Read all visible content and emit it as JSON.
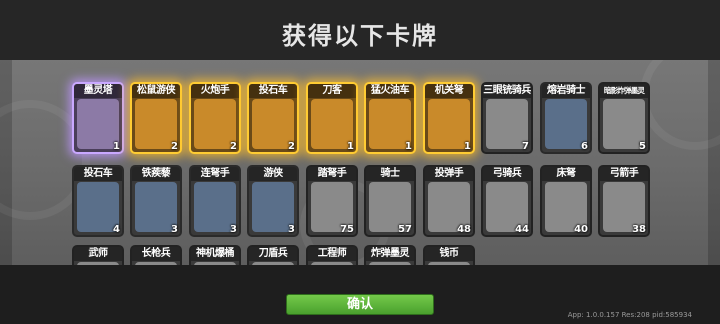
{
  "title": "获得以下卡牌",
  "confirm_label": "确认",
  "version": "App: 1.0.0.157 Res:208 pid:585934",
  "cards": [
    {
      "name": "墨灵塔",
      "count": "1",
      "rarity": "purple",
      "icon": "tower-icon"
    },
    {
      "name": "松鼠游侠",
      "count": "2",
      "rarity": "gold",
      "icon": "ranger-icon"
    },
    {
      "name": "火炮手",
      "count": "2",
      "rarity": "gold",
      "icon": "cannoneer-icon"
    },
    {
      "name": "投石车",
      "count": "2",
      "rarity": "gold",
      "icon": "catapult-icon"
    },
    {
      "name": "刀客",
      "count": "1",
      "rarity": "gold",
      "icon": "blademaster-icon"
    },
    {
      "name": "猛火油车",
      "count": "1",
      "rarity": "gold",
      "icon": "fire-cart-icon"
    },
    {
      "name": "机关弩",
      "count": "1",
      "rarity": "gold",
      "icon": "crossbow-trap-icon"
    },
    {
      "name": "三眼铳骑兵",
      "count": "7",
      "rarity": "gray",
      "icon": "gun-cavalry-icon"
    },
    {
      "name": "熔岩骑士",
      "count": "6",
      "rarity": "blue",
      "icon": "lava-knight-icon"
    },
    {
      "name": "暗影炸弹墨灵",
      "count": "5",
      "rarity": "gray",
      "icon": "shadow-bomb-icon"
    },
    {
      "name": "投石车",
      "count": "4",
      "rarity": "blue",
      "icon": "catapult-icon"
    },
    {
      "name": "铁蒺藜",
      "count": "3",
      "rarity": "blue",
      "icon": "caltrop-icon"
    },
    {
      "name": "连弩手",
      "count": "3",
      "rarity": "blue",
      "icon": "repeating-crossbowman-icon"
    },
    {
      "name": "游侠",
      "count": "3",
      "rarity": "blue",
      "icon": "ranger-icon"
    },
    {
      "name": "踏弩手",
      "count": "75",
      "rarity": "gray",
      "icon": "crossbowman-icon"
    },
    {
      "name": "骑士",
      "count": "57",
      "rarity": "gray",
      "icon": "knight-icon"
    },
    {
      "name": "投弹手",
      "count": "48",
      "rarity": "gray",
      "icon": "bomber-icon"
    },
    {
      "name": "弓骑兵",
      "count": "44",
      "rarity": "gray",
      "icon": "horse-archer-icon"
    },
    {
      "name": "床弩",
      "count": "40",
      "rarity": "gray",
      "icon": "ballista-icon"
    },
    {
      "name": "弓箭手",
      "count": "38",
      "rarity": "gray",
      "icon": "archer-icon"
    },
    {
      "name": "武师",
      "count": "",
      "rarity": "gray",
      "icon": "martial-master-icon"
    },
    {
      "name": "长枪兵",
      "count": "",
      "rarity": "gray",
      "icon": "spearman-icon"
    },
    {
      "name": "神机爆桶",
      "count": "",
      "rarity": "gray",
      "icon": "explosive-barrel-icon"
    },
    {
      "name": "刀盾兵",
      "count": "",
      "rarity": "gray",
      "icon": "shield-soldier-icon"
    },
    {
      "name": "工程师",
      "count": "",
      "rarity": "gray",
      "icon": "engineer-icon"
    },
    {
      "name": "炸弹墨灵",
      "count": "",
      "rarity": "gray",
      "icon": "bomb-spirit-icon"
    },
    {
      "name": "钱币",
      "count": "",
      "rarity": "gray",
      "icon": "coin-icon"
    }
  ],
  "colors": {
    "confirm": "#5cb23a",
    "gold_glow": "#ffcc33",
    "purple_glow": "#c9a8ff"
  }
}
